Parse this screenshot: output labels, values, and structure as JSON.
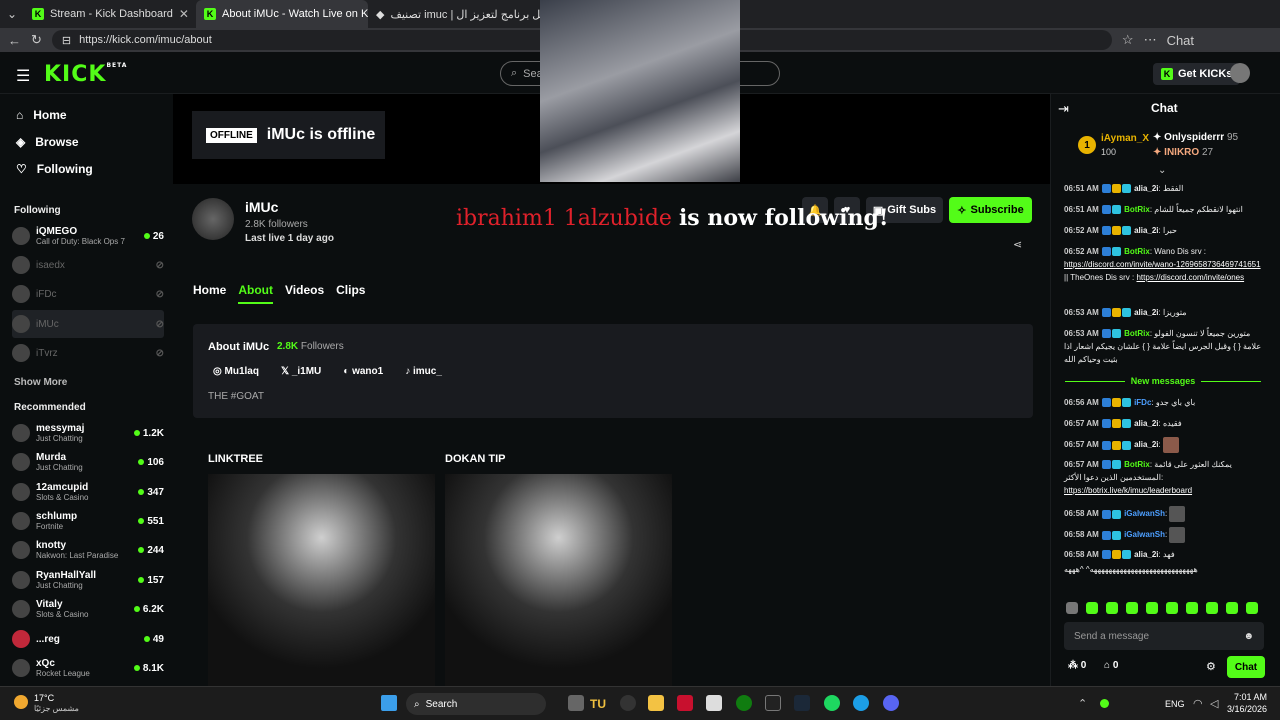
{
  "browser": {
    "tabs": [
      {
        "title": "Stream - Kick Dashboard"
      },
      {
        "title": "About iMUc - Watch Live on Kick"
      },
      {
        "title": "تصنيف imuc | أفضل برنامج لتعزيز ال..."
      }
    ],
    "url": "https://kick.com/imuc/about",
    "chat_label": "Chat"
  },
  "header": {
    "logo": "KICK",
    "logo_beta": "BETA",
    "search_placeholder": "Search",
    "get_kicks": "Get KICKs"
  },
  "sidebar": {
    "nav": [
      {
        "label": "Home",
        "icon": "home-icon"
      },
      {
        "label": "Browse",
        "icon": "browse-icon"
      },
      {
        "label": "Following",
        "icon": "heart-icon"
      }
    ],
    "following_title": "Following",
    "following": [
      {
        "name": "iQMEGO",
        "sub": "Call of Duty: Black Ops 7",
        "viewers": "26",
        "live": true
      },
      {
        "name": "isaedx",
        "sub": "",
        "viewers": "",
        "live": false
      },
      {
        "name": "iFDc",
        "sub": "",
        "viewers": "",
        "live": false
      },
      {
        "name": "iMUc",
        "sub": "",
        "viewers": "",
        "live": false
      },
      {
        "name": "iTvrz",
        "sub": "",
        "viewers": "",
        "live": false
      }
    ],
    "show_more": "Show More",
    "recommended_title": "Recommended",
    "recommended": [
      {
        "name": "messymaj",
        "sub": "Just Chatting",
        "viewers": "1.2K"
      },
      {
        "name": "Murda",
        "sub": "Just Chatting",
        "viewers": "106"
      },
      {
        "name": "12amcupid",
        "sub": "Slots & Casino",
        "viewers": "347"
      },
      {
        "name": "schlump",
        "sub": "Fortnite",
        "viewers": "551"
      },
      {
        "name": "knotty",
        "sub": "Nakwon: Last Paradise",
        "viewers": "244"
      },
      {
        "name": "RyanHallYall",
        "sub": "Just Chatting",
        "viewers": "157"
      },
      {
        "name": "Vitaly",
        "sub": "Slots & Casino",
        "viewers": "6.2K"
      },
      {
        "name": "...reg",
        "sub": "",
        "viewers": "49"
      },
      {
        "name": "xQc",
        "sub": "Rocket League",
        "viewers": "8.1K"
      }
    ]
  },
  "channel": {
    "offline_badge": "OFFLINE",
    "offline_text": "iMUc is offline",
    "name": "iMUc",
    "followers": "2.8K followers",
    "last_live": "Last live 1 day ago",
    "gift_subs": "Gift Subs",
    "subscribe": "Subscribe",
    "tabs": [
      "Home",
      "About",
      "Videos",
      "Clips"
    ],
    "about_title": "About iMUc",
    "about_followers_num": "2.8K",
    "about_followers_label": "Followers",
    "socials": [
      {
        "icon": "instagram-icon",
        "label": "Mu1laq"
      },
      {
        "icon": "x-icon",
        "label": "_i1MU"
      },
      {
        "icon": "discord-icon",
        "label": "wano1"
      },
      {
        "icon": "tiktok-icon",
        "label": "imuc_"
      }
    ],
    "bio": "THE #GOAT",
    "panels": [
      {
        "title": "LINKTREE"
      },
      {
        "title": "DOKAN TIP"
      }
    ]
  },
  "overlay": {
    "name": "ibrahim1 1alzubide",
    "text": "is now following!"
  },
  "chat": {
    "title": "Chat",
    "leaders": [
      {
        "name": "iAyman_X",
        "value": "100",
        "rank": "1"
      },
      {
        "name": "Onlyspiderrr",
        "value": "95"
      },
      {
        "name": "INIKRO",
        "value": "27"
      }
    ],
    "messages": [
      {
        "time": "06:51 AM",
        "user": "alia_2i",
        "text": "الفقط"
      },
      {
        "time": "06:51 AM",
        "user": "BotRix",
        "text": "انتهوا لانقطكم جميعاً للشام"
      },
      {
        "time": "06:52 AM",
        "user": "alia_2i",
        "text": "حبرا"
      },
      {
        "time": "06:52 AM",
        "user": "BotRix",
        "text": "Wano Dis srv :",
        "link": "https://discord.com/invite/wano-1269658736469741651",
        "text2": "|| TheOnes Dis srv :",
        "link2": "https://discord.com/invite/ones"
      },
      {
        "time": "06:53 AM",
        "user": "alia_2i",
        "text": "متوريزا"
      },
      {
        "time": "06:53 AM",
        "user": "BotRix",
        "text": "متورين جميعاً لا تنسون الفولو علامة { } وقبل الجرس ايضاً علامة { } علشان يجيكم اشعار اذا بثيت وحياكم الله"
      }
    ],
    "new_messages": "New messages",
    "messages2": [
      {
        "time": "06:56 AM",
        "user": "iFDc",
        "text": "باي باي جدو"
      },
      {
        "time": "06:57 AM",
        "user": "alia_2i",
        "text": "فقيده"
      },
      {
        "time": "06:57 AM",
        "user": "alia_2i",
        "text": ""
      },
      {
        "time": "06:57 AM",
        "user": "BotRix",
        "text": "يمكنك العثور على قائمة المستخدمين الذين دعوا الأكثر:",
        "link": "https://botrix.live/k/imuc/leaderboard"
      },
      {
        "time": "06:58 AM",
        "user": "iGalwanSh",
        "text": ""
      },
      {
        "time": "06:58 AM",
        "user": "iGalwanSh",
        "text": ""
      },
      {
        "time": "06:58 AM",
        "user": "alia_2i",
        "text": "فهد"
      }
    ],
    "tail": "ههههههههههههههههههههههههههههه^ ^هههه",
    "input_placeholder": "Send a message",
    "points": "0",
    "store": "0",
    "send_label": "Chat"
  },
  "taskbar": {
    "temp": "17°C",
    "weather": "مشمس جزئيًا",
    "search": "Search",
    "lang": "ENG",
    "time": "7:01 AM",
    "date": "3/16/2026"
  }
}
